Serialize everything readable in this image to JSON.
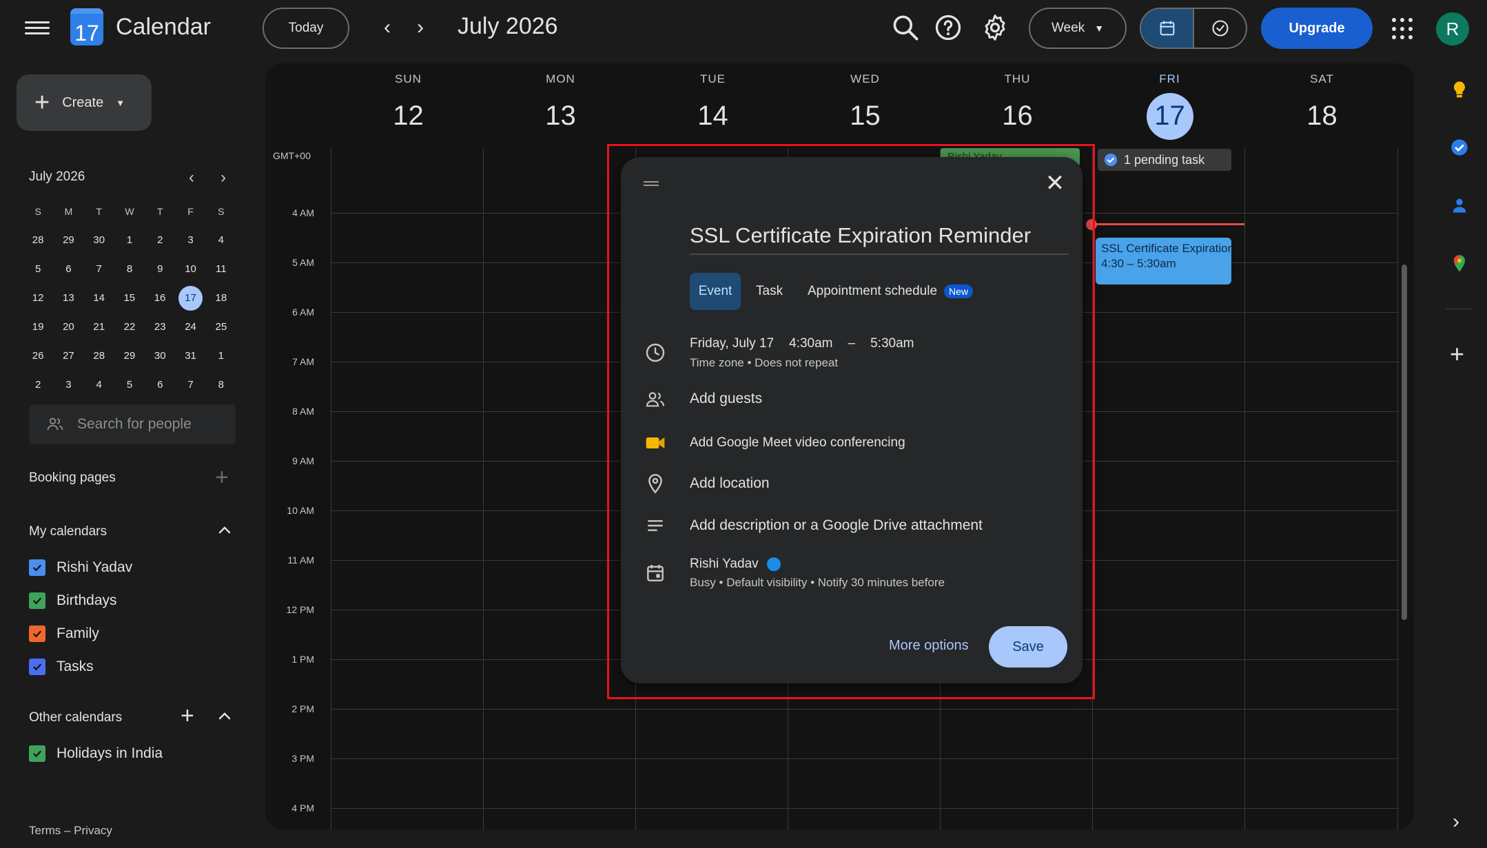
{
  "header": {
    "app_title": "Calendar",
    "logo_day": "17",
    "today_label": "Today",
    "month_title": "July 2026",
    "view_select": "Week",
    "upgrade_label": "Upgrade",
    "avatar_initial": "R"
  },
  "sidebar": {
    "create_label": "Create",
    "mini_month": "July 2026",
    "weekday_heads": [
      "S",
      "M",
      "T",
      "W",
      "T",
      "F",
      "S"
    ],
    "weeks": [
      [
        "28",
        "29",
        "30",
        "1",
        "2",
        "3",
        "4"
      ],
      [
        "5",
        "6",
        "7",
        "8",
        "9",
        "10",
        "11"
      ],
      [
        "12",
        "13",
        "14",
        "15",
        "16",
        "17",
        "18"
      ],
      [
        "19",
        "20",
        "21",
        "22",
        "23",
        "24",
        "25"
      ],
      [
        "26",
        "27",
        "28",
        "29",
        "30",
        "31",
        "1"
      ],
      [
        "2",
        "3",
        "4",
        "5",
        "6",
        "7",
        "8"
      ]
    ],
    "search_placeholder": "Search for people",
    "booking_pages": "Booking pages",
    "my_calendars_label": "My calendars",
    "my_calendars": [
      {
        "name": "Rishi Yadav",
        "color": "#4a8ef0"
      },
      {
        "name": "Birthdays",
        "color": "#3fa35b"
      },
      {
        "name": "Family",
        "color": "#f0672b"
      },
      {
        "name": "Tasks",
        "color": "#4a6ef0"
      }
    ],
    "other_calendars_label": "Other calendars",
    "other_calendars": [
      {
        "name": "Holidays in India",
        "color": "#3fa35b"
      }
    ],
    "footer": "Terms – Privacy"
  },
  "week": {
    "days": [
      {
        "name": "SUN",
        "num": "12"
      },
      {
        "name": "MON",
        "num": "13"
      },
      {
        "name": "TUE",
        "num": "14"
      },
      {
        "name": "WED",
        "num": "15"
      },
      {
        "name": "THU",
        "num": "16"
      },
      {
        "name": "FRI",
        "num": "17"
      },
      {
        "name": "SAT",
        "num": "18"
      }
    ],
    "timezone": "GMT+00",
    "hours": [
      "4 AM",
      "5 AM",
      "6 AM",
      "7 AM",
      "8 AM",
      "9 AM",
      "10 AM",
      "11 AM",
      "12 PM",
      "1 PM",
      "2 PM",
      "3 PM",
      "4 PM"
    ],
    "pending_task": "1 pending task",
    "birthday_chip": "Rishi Yadav",
    "event_chip_title": "SSL Certificate Expiration Reminder",
    "event_chip_time": "4:30 – 5:30am"
  },
  "dialog": {
    "title": "SSL Certificate Expiration Reminder",
    "tab_event": "Event",
    "tab_task": "Task",
    "tab_appointment": "Appointment schedule",
    "new_badge": "New",
    "date": "Friday, July 17",
    "start_time": "4:30am",
    "dash": "–",
    "end_time": "5:30am",
    "tz_repeat": "Time zone • Does not repeat",
    "add_guests": "Add guests",
    "add_meet": "Add Google Meet video conferencing",
    "add_location": "Add location",
    "add_description": "Add description or a Google Drive attachment",
    "calendar_owner": "Rishi Yadav",
    "calendar_details": "Busy • Default visibility • Notify 30 minutes before",
    "more_options": "More options",
    "save": "Save"
  },
  "colors": {
    "accent": "#a8c7fa",
    "event_blue": "#4aa3e8",
    "highlight_red": "#e8131e",
    "now_line": "#e84a4a"
  },
  "icons": [
    "menu-icon",
    "search-icon",
    "help-icon",
    "settings-icon",
    "calendar-view-icon",
    "tasks-view-icon",
    "apps-icon",
    "plus-icon",
    "people-icon",
    "clock-icon",
    "meet-icon",
    "location-icon",
    "description-icon",
    "calendar-icon",
    "close-icon"
  ]
}
